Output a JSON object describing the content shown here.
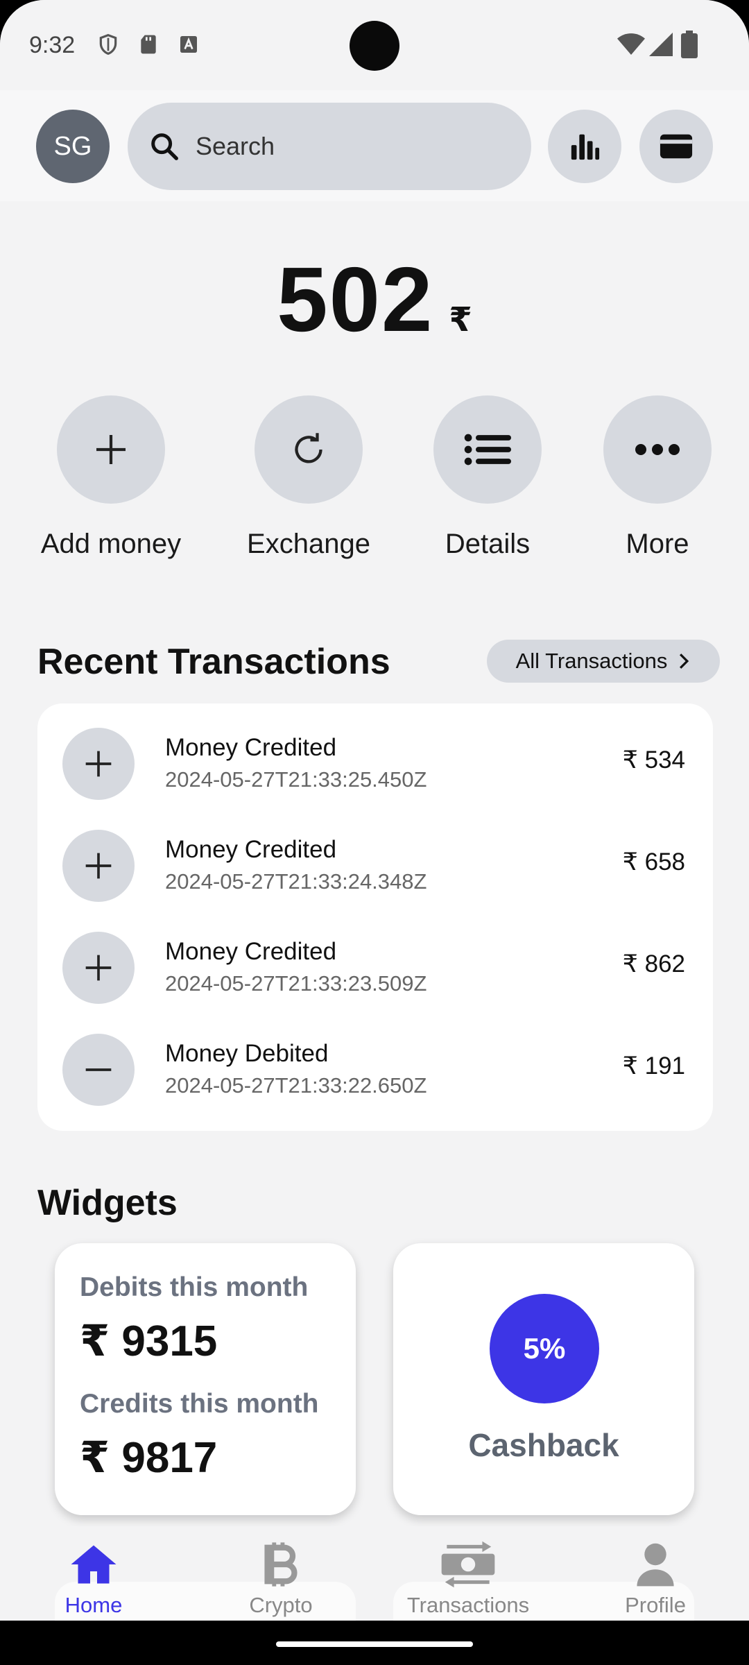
{
  "status_bar": {
    "time": "9:32",
    "left_icons": [
      "shield-icon",
      "sd-card-icon",
      "keyboard-a-icon"
    ],
    "right_icons": [
      "wifi-icon",
      "signal-icon",
      "battery-icon"
    ]
  },
  "header": {
    "avatar_initials": "SG",
    "search_placeholder": "Search",
    "buttons": [
      "bar-chart-icon",
      "card-icon"
    ]
  },
  "balance": {
    "value": "502",
    "currency": "₹"
  },
  "actions": [
    {
      "label": "Add money",
      "icon": "plus-icon"
    },
    {
      "label": "Exchange",
      "icon": "refresh-icon"
    },
    {
      "label": "Details",
      "icon": "list-icon"
    },
    {
      "label": "More",
      "icon": "more-icon"
    }
  ],
  "recent": {
    "title": "Recent Transactions",
    "all_button": "All Transactions",
    "items": [
      {
        "title": "Money Credited",
        "date": "2024-05-27T21:33:25.450Z",
        "amount": "₹ 534",
        "type": "credit"
      },
      {
        "title": "Money Credited",
        "date": "2024-05-27T21:33:24.348Z",
        "amount": "₹ 658",
        "type": "credit"
      },
      {
        "title": "Money Credited",
        "date": "2024-05-27T21:33:23.509Z",
        "amount": "₹ 862",
        "type": "credit"
      },
      {
        "title": "Money Debited",
        "date": "2024-05-27T21:33:22.650Z",
        "amount": "₹ 191",
        "type": "debit"
      }
    ]
  },
  "widgets": {
    "title": "Widgets",
    "debits_label": "Debits this month",
    "debits_value": "₹ 9315",
    "credits_label": "Credits this month",
    "credits_value": "₹ 9817",
    "cashback_percent": "5%",
    "cashback_label": "Cashback"
  },
  "nav": {
    "items": [
      {
        "label": "Home",
        "icon": "home-icon",
        "active": true
      },
      {
        "label": "Crypto",
        "icon": "bitcoin-icon",
        "active": false
      },
      {
        "label": "Transactions",
        "icon": "money-transfer-icon",
        "active": false
      },
      {
        "label": "Profile",
        "icon": "person-icon",
        "active": false
      }
    ]
  },
  "colors": {
    "accent": "#3d35e6",
    "chip_bg": "#d6d9df",
    "background": "#f3f3f4",
    "muted_text": "#6b7280"
  }
}
